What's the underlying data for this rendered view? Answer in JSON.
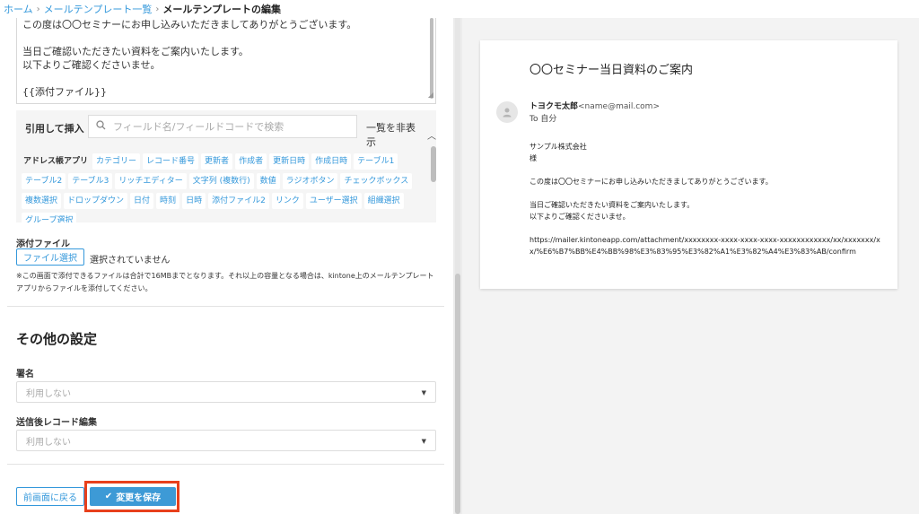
{
  "breadcrumb": {
    "home": "ホーム",
    "list": "メールテンプレート一覧",
    "current": "メールテンプレートの編集"
  },
  "editor": {
    "body_lines": [
      "この度は〇〇セミナーにお申し込みいただきましてありがとうございます。",
      "",
      "当日ご確認いただきたい資料をご案内いたします。",
      "以下よりご確認くださいませ。",
      "",
      "{{添付ファイル}}"
    ]
  },
  "insert": {
    "label": "引用して挿入",
    "search_placeholder": "フィールド名/フィールドコードで検索",
    "toggle_label": "一覧を非表示",
    "group_label": "アドレス帳アプリ",
    "fields": [
      "カテゴリー",
      "レコード番号",
      "更新者",
      "作成者",
      "更新日時",
      "作成日時",
      "テーブル1",
      "テーブル2",
      "テーブル3",
      "リッチエディター",
      "文字列 (複数行)",
      "数値",
      "ラジオボタン",
      "チェックボックス",
      "複数選択",
      "ドロップダウン",
      "日付",
      "時刻",
      "日時",
      "添付ファイル2",
      "リンク",
      "ユーザー選択",
      "組織選択",
      "グループ選択"
    ]
  },
  "attachment": {
    "title": "添付ファイル",
    "button": "ファイル選択",
    "status": "選択されていません",
    "note": "※この画面で添付できるファイルは合計で16MBまでとなります。それ以上の容量となる場合は、kintone上のメールテンプレートアプリからファイルを添付してください。"
  },
  "other": {
    "title": "その他の設定",
    "signature_label": "署名",
    "signature_value": "利用しない",
    "record_edit_label": "送信後レコード編集",
    "record_edit_value": "利用しない"
  },
  "actions": {
    "back": "前画面に戻る",
    "save": "変更を保存"
  },
  "preview": {
    "subject": "〇〇セミナー当日資料のご案内",
    "from_name": "トヨクモ太郎",
    "from_addr": "<name@mail.com>",
    "to": "To 自分",
    "body_lines": [
      "サンプル株式会社",
      "様",
      "",
      "この度は〇〇セミナーにお申し込みいただきましてありがとうございます。",
      "",
      "当日ご確認いただきたい資料をご案内いたします。",
      "以下よりご確認くださいませ。",
      ""
    ],
    "url": "https://mailer.kintoneapp.com/attachment/xxxxxxxx-xxxx-xxxx-xxxx-xxxxxxxxxxxx/xx/xxxxxxx/xx/%E6%B7%BB%E4%BB%98%E3%83%95%E3%82%A1%E3%82%A4%E3%83%AB/confirm"
  },
  "colors": {
    "accent": "#3498db",
    "save_bg": "#3d9ad6",
    "highlight": "#e8401c"
  }
}
